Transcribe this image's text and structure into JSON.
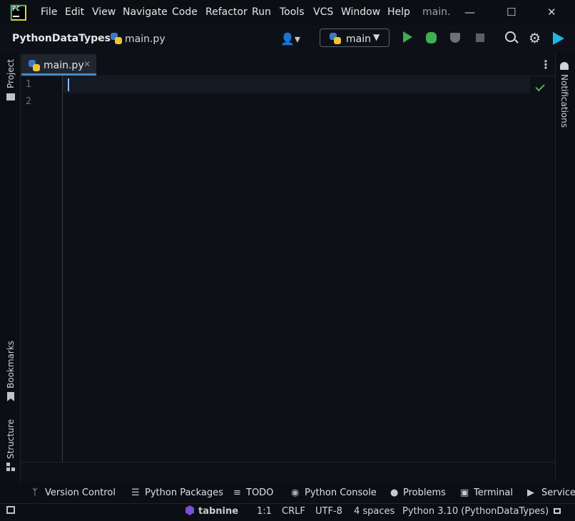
{
  "window": {
    "menu": [
      "File",
      "Edit",
      "View",
      "Navigate",
      "Code",
      "Refactor",
      "Run",
      "Tools",
      "VCS",
      "Window",
      "Help"
    ],
    "title": "main."
  },
  "navbar": {
    "project": "PythonDataTypes",
    "file": "main.py",
    "run_config": "main"
  },
  "left_tools": {
    "project": "Project",
    "bookmarks": "Bookmarks",
    "structure": "Structure"
  },
  "right_tools": {
    "notifications": "Notifications"
  },
  "tabs": [
    {
      "label": "main.py",
      "active": true
    }
  ],
  "editor": {
    "line_numbers": [
      "1",
      "2"
    ]
  },
  "tool_windows": [
    {
      "label": "Version Control",
      "icon": "version-control-icon"
    },
    {
      "label": "Python Packages",
      "icon": "packages-icon"
    },
    {
      "label": "TODO",
      "icon": "todo-icon"
    },
    {
      "label": "Python Console",
      "icon": "python-console-icon"
    },
    {
      "label": "Problems",
      "icon": "problems-icon"
    },
    {
      "label": "Terminal",
      "icon": "terminal-icon"
    },
    {
      "label": "Services",
      "icon": "services-icon"
    }
  ],
  "status": {
    "plugin": "tabnine",
    "position": "1:1",
    "line_sep": "CRLF",
    "encoding": "UTF-8",
    "indent": "4 spaces",
    "interpreter": "Python 3.10 (PythonDataTypes)"
  },
  "colors": {
    "accent": "#4a88c7",
    "run": "#3fae4f",
    "background": "#0d1117"
  }
}
